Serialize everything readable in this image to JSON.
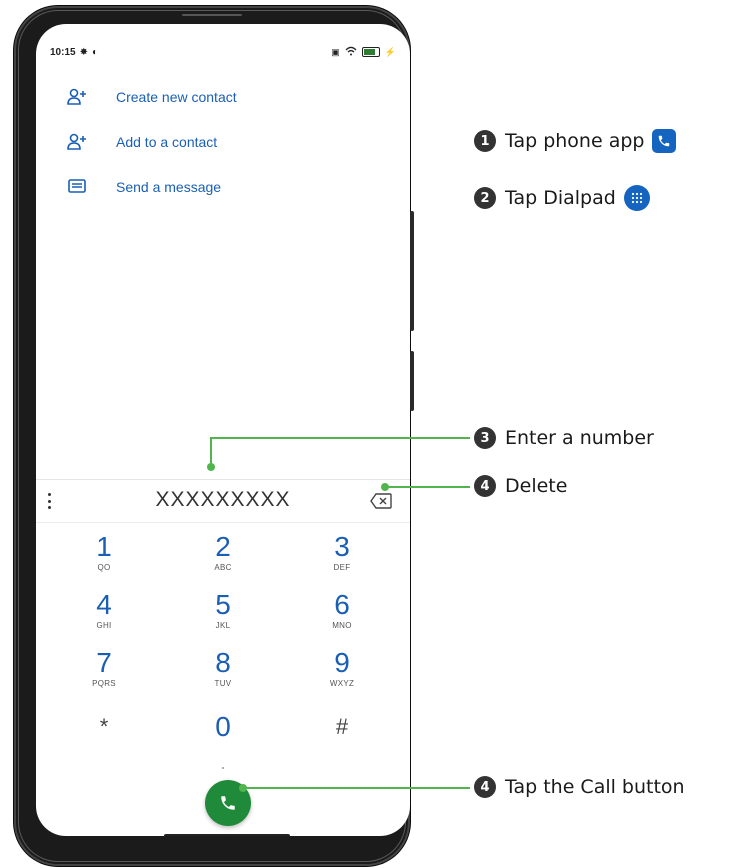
{
  "status_bar": {
    "time": "10:15"
  },
  "menu": [
    {
      "label": "Create new contact",
      "icon": "add-person-icon"
    },
    {
      "label": "Add to a contact",
      "icon": "add-person-icon"
    },
    {
      "label": "Send a message",
      "icon": "message-icon"
    }
  ],
  "dialer": {
    "number": "XXXXXXXXX",
    "keys": [
      {
        "digit": "1",
        "letters": "QO"
      },
      {
        "digit": "2",
        "letters": "ABC"
      },
      {
        "digit": "3",
        "letters": "DEF"
      },
      {
        "digit": "4",
        "letters": "GHI"
      },
      {
        "digit": "5",
        "letters": "JKL"
      },
      {
        "digit": "6",
        "letters": "MNO"
      },
      {
        "digit": "7",
        "letters": "PQRS"
      },
      {
        "digit": "8",
        "letters": "TUV"
      },
      {
        "digit": "9",
        "letters": "WXYZ"
      },
      {
        "digit": "*",
        "letters": ""
      },
      {
        "digit": "0",
        "letters": ""
      },
      {
        "digit": "#",
        "letters": ""
      }
    ]
  },
  "annotations": {
    "step1": {
      "num": "1",
      "text": "Tap phone app"
    },
    "step2": {
      "num": "2",
      "text": "Tap Dialpad"
    },
    "step3": {
      "num": "3",
      "text": "Enter a number"
    },
    "step4a": {
      "num": "4",
      "text": "Delete"
    },
    "step4b": {
      "num": "4",
      "text": "Tap the Call button"
    }
  },
  "colors": {
    "accent": "#1a5fb4",
    "call_green": "#1f8a3a",
    "leader_green": "#52b44c"
  }
}
